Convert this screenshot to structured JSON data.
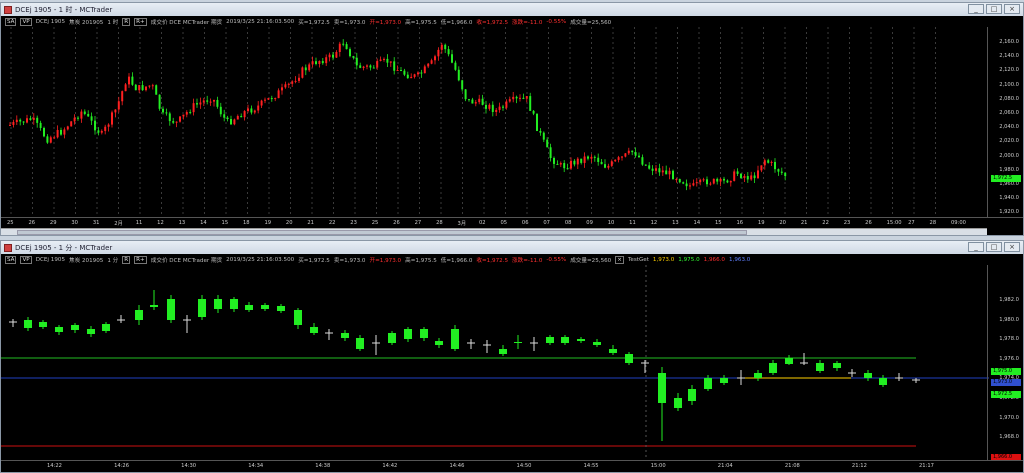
{
  "top_window": {
    "title": "DCEj 1905 - 1 时 - MCTrader",
    "info": {
      "tags": [
        "SA",
        "VP"
      ],
      "symbol": "DCEj 1905",
      "name": "焦炭 201905",
      "period": "1 时",
      "r_label": "R",
      "rplus_label": "R+",
      "fields": "成交价  DCE  MCTrader  期货",
      "datetime": "2019/3/25  21:16:03.500",
      "buy": "买=1,972.5",
      "sell": "卖=1,973.0",
      "open": "开=1,973.0",
      "high": "高=1,975.5",
      "low": "低=1,966.0",
      "close": "收=1,972.5",
      "change": "涨跌=-11.0",
      "change_pct": "-0.55%",
      "volume": "成交量=25,560"
    },
    "y_ticks": [
      "2,160.0",
      "2,140.0",
      "2,120.0",
      "2,100.0",
      "2,080.0",
      "2,060.0",
      "2,040.0",
      "2,020.0",
      "2,000.0",
      "1,980.0",
      "1,960.0",
      "1,940.0",
      "1,920.0"
    ],
    "price_tag": "1,972.5",
    "x_ticks": [
      "25",
      "26",
      "29",
      "30",
      "31",
      "2月",
      "11",
      "12",
      "13",
      "14",
      "15",
      "18",
      "19",
      "20",
      "21",
      "22",
      "23",
      "25",
      "26",
      "27",
      "28",
      "3月",
      "02",
      "05",
      "06",
      "07",
      "08",
      "09",
      "10",
      "11",
      "12",
      "13",
      "14",
      "15",
      "16",
      "19",
      "20",
      "21",
      "22",
      "23",
      "26",
      "15:00",
      "27",
      "28",
      "09:00"
    ],
    "buttons": {
      "minimize": "_",
      "maximize": "□",
      "close": "×"
    }
  },
  "bottom_window": {
    "title": "DCEj 1905 - 1 分 - MCTrader",
    "info": {
      "tags": [
        "SA",
        "VP"
      ],
      "symbol": "DCEj 1905",
      "name": "焦炭 201905",
      "period": "1 分",
      "r_label": "R",
      "rplus_label": "R+",
      "fields": "成交价  DCE  MCTrader  期货",
      "datetime": "2019/3/25  21:16:03.500",
      "buy": "买=1,972.5",
      "sell": "卖=1,973.0",
      "open": "开=1,973.0",
      "high": "高=1,975.5",
      "low": "低=1,966.0",
      "close": "收=1,972.5",
      "change": "涨跌=-11.0",
      "change_pct": "-0.55%",
      "volume": "成交量=25,560",
      "study": "TestGet",
      "study_v1": "1,973.0",
      "study_v2": "1,975.0",
      "study_v3": "1,966.0",
      "study_v4": "1,963.0"
    },
    "y_ticks": [
      "1,982.0",
      "1,980.0",
      "1,978.0",
      "1,976.0",
      "1,974.0",
      "1,972.0",
      "1,970.0",
      "1,968.0"
    ],
    "tags": {
      "green": "1,975.0",
      "blue": "1,973.0",
      "price": "1,972.5",
      "red": "1,966.0"
    },
    "x_ticks": [
      "14:22",
      "14:26",
      "14:30",
      "14:34",
      "14:38",
      "14:42",
      "14:46",
      "14:50",
      "14:55",
      "15:00",
      "21:04",
      "21:08",
      "21:12",
      "21:17"
    ],
    "buttons": {
      "minimize": "_",
      "maximize": "□",
      "close": "×"
    }
  },
  "colors": {
    "up": "#ff2020",
    "down": "#22ee22",
    "doji": "#dddddd",
    "green_line": "#22bb22",
    "blue_line": "#2040c0",
    "red_line": "#cc1010"
  }
}
